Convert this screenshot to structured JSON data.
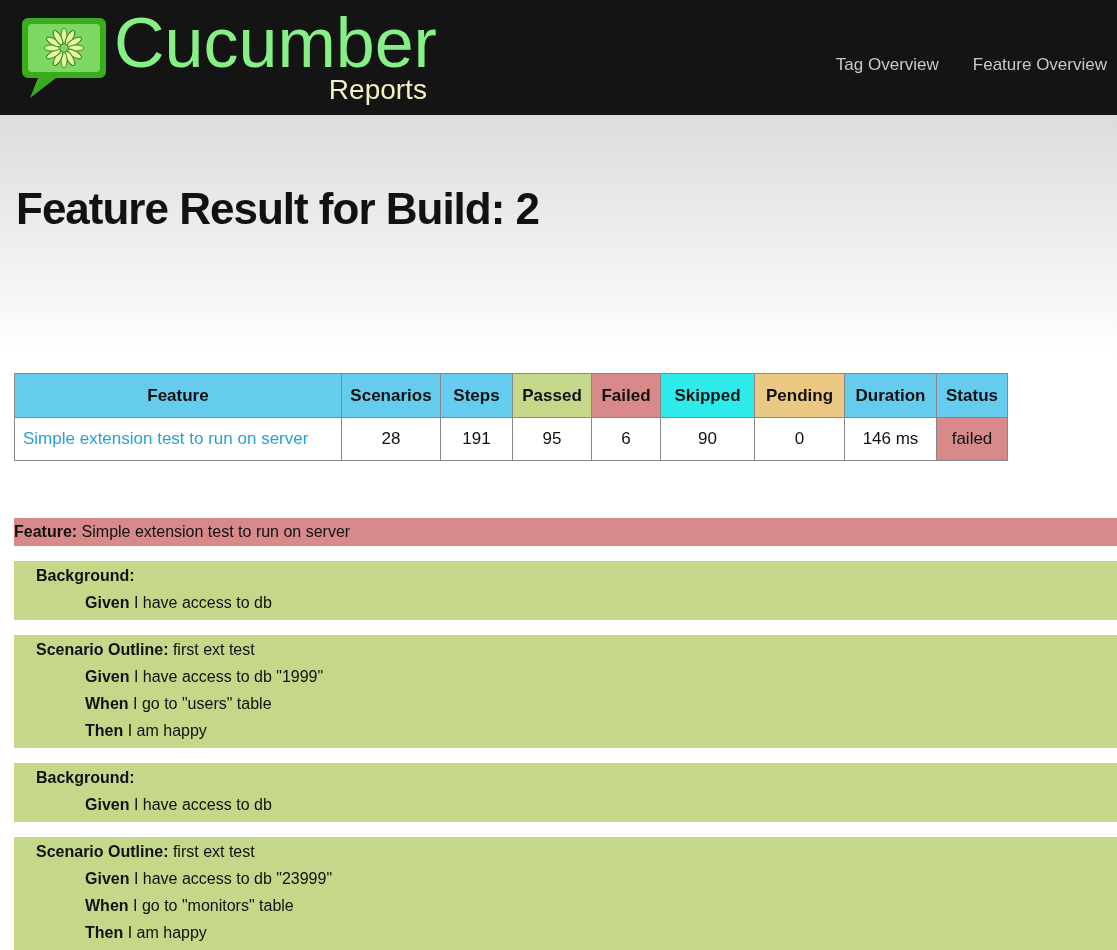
{
  "header": {
    "logo_title": "Cucumber",
    "logo_subtitle": "Reports",
    "nav": [
      "Tag Overview",
      "Feature Overview"
    ]
  },
  "title": "Feature Result for Build: 2",
  "table": {
    "columns": [
      {
        "label": "Feature",
        "kind": "plain"
      },
      {
        "label": "Scenarios",
        "kind": "plain"
      },
      {
        "label": "Steps",
        "kind": "plain"
      },
      {
        "label": "Passed",
        "kind": "passed"
      },
      {
        "label": "Failed",
        "kind": "failed"
      },
      {
        "label": "Skipped",
        "kind": "skipped"
      },
      {
        "label": "Pending",
        "kind": "pending"
      },
      {
        "label": "Duration",
        "kind": "plain"
      },
      {
        "label": "Status",
        "kind": "plain"
      }
    ],
    "rows": [
      {
        "cells": [
          "Simple extension test to run on server",
          "28",
          "191",
          "95",
          "6",
          "90",
          "0",
          "146 ms",
          "failed"
        ],
        "failed": true
      }
    ]
  },
  "feature": {
    "title": "**Feature:** Simple extension test to run on server",
    "failed": true
  },
  "sections": [
    {
      "kind": "background",
      "title": "Background:",
      "failed": false,
      "steps": [
        "**Given** I have access to db"
      ]
    },
    {
      "kind": "scenario_outline",
      "title": "**Scenario Outline:** first ext test",
      "failed": false,
      "steps": [
        "**Given** I have access to db \"1999\"",
        "**When** I go to \"users\" table",
        "**Then** I am happy"
      ]
    },
    {
      "kind": "background",
      "title": "Background:",
      "failed": false,
      "steps": [
        "**Given** I have access to db"
      ]
    },
    {
      "kind": "scenario_outline",
      "title": "**Scenario Outline:** first ext test",
      "failed": false,
      "steps": [
        "**Given** I have access to db \"23999\"",
        "**When** I go to \"monitors\" table",
        "**Then** I am happy"
      ]
    }
  ]
}
